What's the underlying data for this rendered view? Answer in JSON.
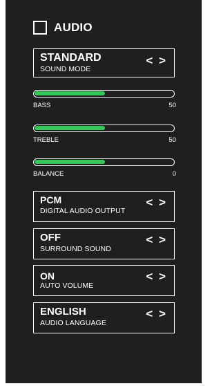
{
  "header": {
    "title": "AUDIO"
  },
  "sound_mode": {
    "value": "STANDARD",
    "label": "SOUND MODE",
    "arrows": "< >"
  },
  "sliders": [
    {
      "label": "BASS",
      "value": "50",
      "level_percent": 50
    },
    {
      "label": "TREBLE",
      "value": "50",
      "level_percent": 50
    },
    {
      "label": "BALANCE",
      "value": "0",
      "level_percent": 50
    }
  ],
  "options": [
    {
      "value": "PCM",
      "label": "DIGITAL AUDIO OUTPUT",
      "arrows": "< >"
    },
    {
      "value": "OFF",
      "label": "SURROUND SOUND",
      "arrows": "< >"
    },
    {
      "value": "ON",
      "label": "AUTO VOLUME",
      "arrows": "< >"
    },
    {
      "value": "ENGLISH",
      "label": "AUDIO LANGUAGE",
      "arrows": "< >"
    }
  ],
  "colors": {
    "background": "#1f1f1f",
    "foreground": "#ffffff",
    "slider_fill": "#34c759"
  }
}
